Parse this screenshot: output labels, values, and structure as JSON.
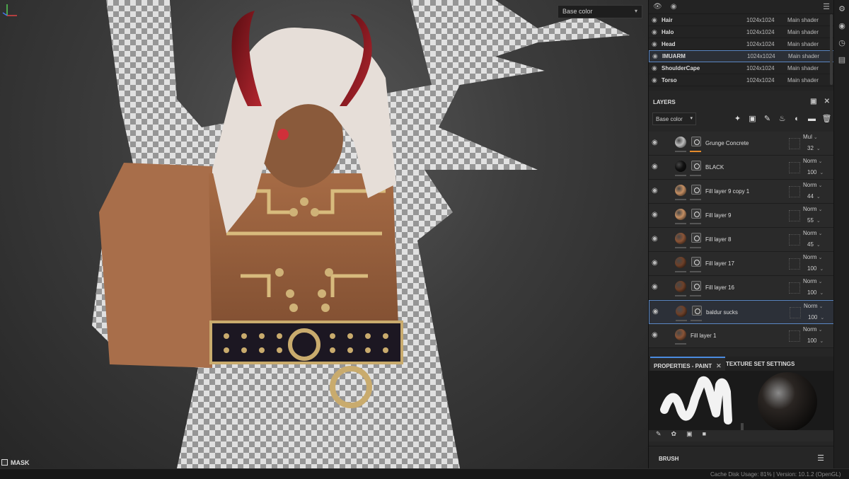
{
  "viewport": {
    "channel_dropdown": "Base color",
    "mask_label": "MASK"
  },
  "texture_sets": {
    "rows": [
      {
        "name": "Hair",
        "resolution": "1024x1024",
        "shader": "Main shader",
        "selected": false
      },
      {
        "name": "Halo",
        "resolution": "1024x1024",
        "shader": "Main shader",
        "selected": false
      },
      {
        "name": "Head",
        "resolution": "1024x1024",
        "shader": "Main shader",
        "selected": false
      },
      {
        "name": "IMUARM",
        "resolution": "1024x1024",
        "shader": "Main shader",
        "selected": true
      },
      {
        "name": "ShoulderCape",
        "resolution": "1024x1024",
        "shader": "Main shader",
        "selected": false
      },
      {
        "name": "Torso",
        "resolution": "1024x1024",
        "shader": "Main shader",
        "selected": false
      }
    ]
  },
  "layers": {
    "title": "LAYERS",
    "channel": "Base color",
    "items": [
      {
        "name": "Grunge Concrete",
        "blend": "Mul",
        "opacity": "32",
        "thumb": "#bdbdbd",
        "orange": true,
        "selected": false
      },
      {
        "name": "BLACK",
        "blend": "Norm",
        "opacity": "100",
        "thumb": "#111111",
        "orange": false,
        "selected": false
      },
      {
        "name": "Fill layer 9 copy 1",
        "blend": "Norm",
        "opacity": "44",
        "thumb": "#c48e62",
        "orange": false,
        "selected": false
      },
      {
        "name": "Fill layer 9",
        "blend": "Norm",
        "opacity": "55",
        "thumb": "#c48e62",
        "orange": false,
        "selected": false
      },
      {
        "name": "Fill layer 8",
        "blend": "Norm",
        "opacity": "45",
        "thumb": "#8a5436",
        "orange": false,
        "selected": false
      },
      {
        "name": "Fill layer 17",
        "blend": "Norm",
        "opacity": "100",
        "thumb": "#6e4028",
        "orange": false,
        "selected": false
      },
      {
        "name": "Fill layer 16",
        "blend": "Norm",
        "opacity": "100",
        "thumb": "#6e4028",
        "orange": false,
        "selected": false
      },
      {
        "name": "baldur sucks",
        "blend": "Norm",
        "opacity": "100",
        "thumb": "#6e4028",
        "orange": false,
        "selected": true
      },
      {
        "name": "Fill layer 1",
        "blend": "Norm",
        "opacity": "100",
        "thumb": "#8a5436",
        "orange": false,
        "selected": false
      }
    ]
  },
  "properties": {
    "tab_paint": "PROPERTIES - PAINT",
    "tab_texture": "TEXTURE SET SETTINGS",
    "brush_label": "BRUSH"
  },
  "status": {
    "text": "Cache Disk Usage: 81% | Version: 10.1.2 (OpenGL)"
  }
}
